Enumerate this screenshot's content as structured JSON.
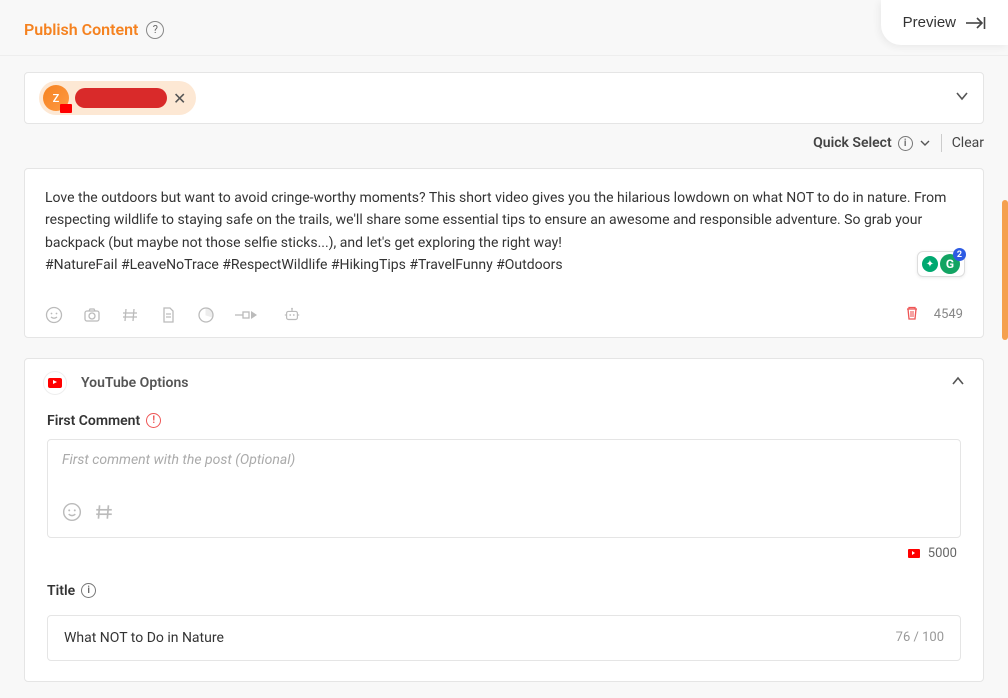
{
  "header": {
    "title": "Publish Content",
    "preview_label": "Preview"
  },
  "account": {
    "avatar_letter": "Z"
  },
  "quick": {
    "label": "Quick Select",
    "clear": "Clear"
  },
  "composer": {
    "body": "Love the outdoors but want to avoid cringe-worthy moments? This short video gives you the hilarious lowdown on what NOT to do in nature. From respecting wildlife to staying safe on the trails, we'll share some essential tips to ensure an awesome and responsible adventure. So grab your backpack (but maybe not those selfie sticks...), and let's get exploring the right way!",
    "hashtags": "#NatureFail #LeaveNoTrace #RespectWildlife #HikingTips #TravelFunny #Outdoors",
    "char_count": "4549",
    "grammarly_badge": "2"
  },
  "youtube": {
    "section_title": "YouTube Options",
    "first_comment_label": "First Comment",
    "first_comment_placeholder": "First comment with the post (Optional)",
    "first_comment_limit": "5000",
    "title_label": "Title",
    "title_value": "What NOT to Do in Nature",
    "title_count": "76 / 100"
  }
}
